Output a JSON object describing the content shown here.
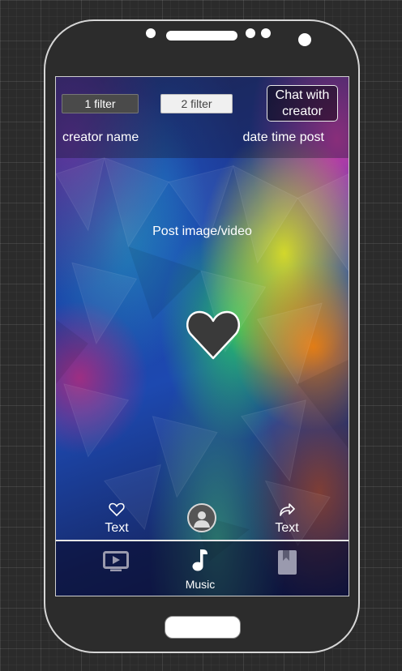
{
  "filters": {
    "filter_one": "1 filter",
    "filter_two": "2 filter"
  },
  "chat_button": {
    "label": "Chat with creator"
  },
  "post": {
    "creator_name": "creator name",
    "date_time": "date time post",
    "media_placeholder": "Post image/video"
  },
  "actions": {
    "like_label": "Text",
    "share_label": "Text"
  },
  "bottom_nav": {
    "music_label": "Music",
    "items": [
      {
        "icon": "video-player-icon"
      },
      {
        "icon": "music-note-icon"
      },
      {
        "icon": "bookmark-book-icon"
      }
    ]
  },
  "colors": {
    "phone_body": "#2c2c2c",
    "screen_border": "#cfcfcf",
    "filter_one_bg": "#4a4a4a",
    "filter_two_bg": "#f0f0f0",
    "heart": "#3a3a3a",
    "nav_icon_muted": "#9a9aae"
  }
}
